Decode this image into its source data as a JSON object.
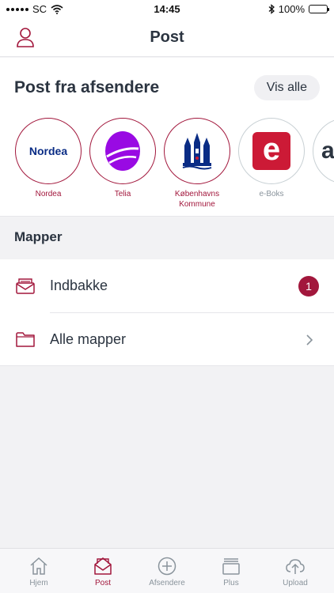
{
  "status_bar": {
    "carrier": "SC",
    "time": "14:45",
    "battery": "100%"
  },
  "nav": {
    "title": "Post"
  },
  "senders_section": {
    "heading": "Post fra afsendere",
    "show_all_label": "Vis alle",
    "senders": [
      {
        "name": "Nordea",
        "logo_text": "Nordea"
      },
      {
        "name": "Telia"
      },
      {
        "name": "Københavns Kommune"
      },
      {
        "name": "e-Boks",
        "logo_text": "e"
      },
      {
        "logo_text": "a"
      }
    ]
  },
  "folders_section": {
    "heading": "Mapper",
    "items": [
      {
        "label": "Indbakke",
        "badge": "1",
        "icon": "inbox-icon"
      },
      {
        "label": "Alle mapper",
        "icon": "folder-icon"
      }
    ]
  },
  "tabbar": {
    "tabs": [
      {
        "label": "Hjem",
        "icon": "home-icon"
      },
      {
        "label": "Post",
        "icon": "mail-icon",
        "active": true
      },
      {
        "label": "Afsendere",
        "icon": "plus-circle-icon"
      },
      {
        "label": "Plus",
        "icon": "stack-icon"
      },
      {
        "label": "Upload",
        "icon": "cloud-upload-icon"
      }
    ]
  },
  "colors": {
    "accent": "#a2173c",
    "text": "#2b3440",
    "muted": "#8a949c",
    "nordea_blue": "#0a2c85",
    "telia_purple": "#990ae3",
    "eboks_red": "#cc1a36"
  }
}
